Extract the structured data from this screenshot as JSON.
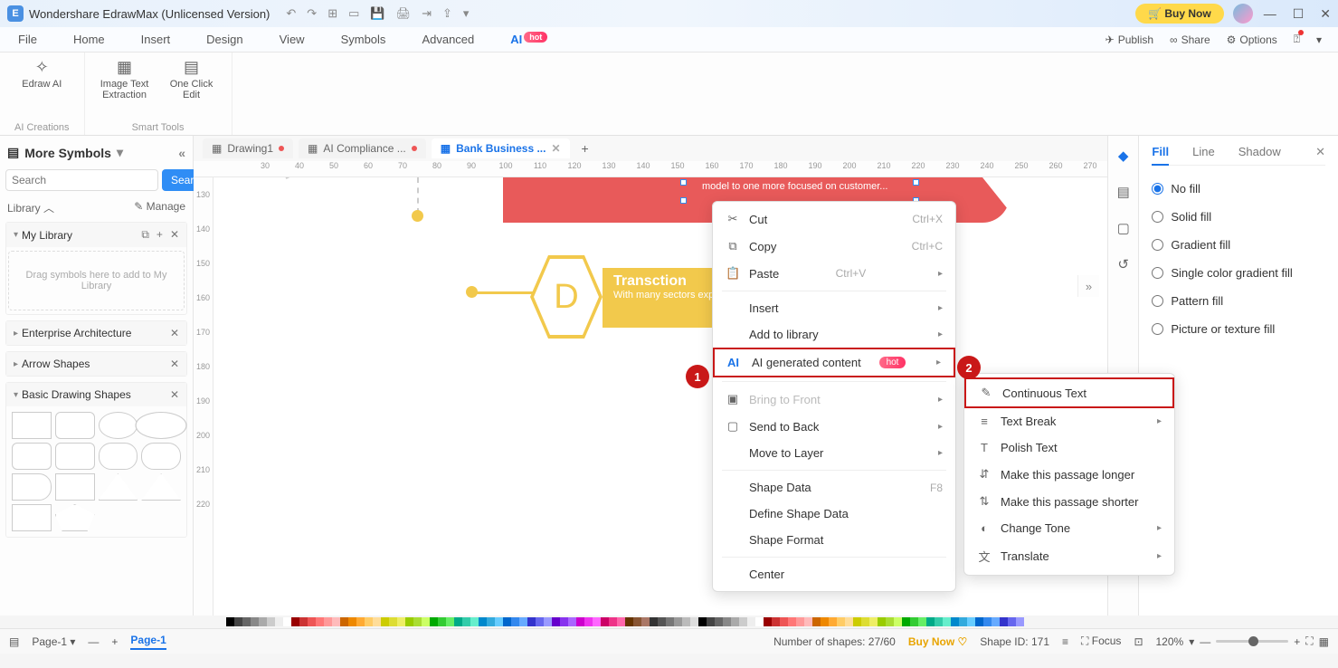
{
  "app": {
    "title": "Wondershare EdrawMax (Unlicensed Version)",
    "buynow": "🛒 Buy Now"
  },
  "winctrl": {
    "min": "—",
    "max": "☐",
    "close": "✕"
  },
  "menubar": {
    "tabs": [
      "File",
      "Home",
      "Insert",
      "Design",
      "View",
      "Symbols",
      "Advanced",
      "AI"
    ],
    "active": "AI",
    "hot": "hot",
    "right": {
      "publish": "Publish",
      "share": "Share",
      "options": "Options"
    }
  },
  "ribbon": {
    "g1": {
      "name": "AI Creations",
      "t1": "Edraw AI"
    },
    "g2": {
      "name": "Smart Tools",
      "t1": "Image Text Extraction",
      "t2": "One Click Edit"
    }
  },
  "left": {
    "title": "More Symbols",
    "searchPlaceholder": "Search",
    "searchBtn": "Search",
    "library": "Library",
    "manage": "Manage",
    "mylib": "My Library",
    "drop": "Drag symbols here to add to My Library",
    "sec1": "Enterprise Architecture",
    "sec2": "Arrow Shapes",
    "sec3": "Basic Drawing Shapes"
  },
  "tabs": {
    "t1": "Drawing1",
    "t2": "AI Compliance ...",
    "t3": "Bank Business ..."
  },
  "rulerH": [
    " ",
    "30",
    "40",
    "50",
    "60",
    "70",
    "80",
    "90",
    "100",
    "110",
    "120",
    "130",
    "140",
    "150",
    "160",
    "170",
    "180",
    "190",
    "200",
    "210",
    "220",
    "230",
    "240",
    "250",
    "260",
    "270"
  ],
  "rulerV": [
    "130",
    "140",
    "150",
    "160",
    "170",
    "180",
    "190",
    "200",
    "210",
    "220"
  ],
  "canvas": {
    "redText": "model to one more focused on customer...",
    "yellowTitle": "Transction",
    "yellowBody": "With many sectors experiencing stress, to gain priority...",
    "hexLetter": "D"
  },
  "ctx": {
    "cut": "Cut",
    "cutK": "Ctrl+X",
    "copy": "Copy",
    "copyK": "Ctrl+C",
    "paste": "Paste",
    "pasteK": "Ctrl+V",
    "insert": "Insert",
    "addlib": "Add to library",
    "ai": "AI generated content",
    "hot": "hot",
    "bring": "Bring to Front",
    "send": "Send to Back",
    "move": "Move to Layer",
    "sdata": "Shape Data",
    "sdataK": "F8",
    "define": "Define Shape Data",
    "format": "Shape Format",
    "center": "Center"
  },
  "sub": {
    "cont": "Continuous Text",
    "break": "Text Break",
    "polish": "Polish Text",
    "longer": "Make this passage longer",
    "shorter": "Make this passage shorter",
    "tone": "Change Tone",
    "trans": "Translate"
  },
  "props": {
    "tabs": {
      "fill": "Fill",
      "line": "Line",
      "shadow": "Shadow"
    },
    "opts": {
      "nofill": "No fill",
      "solid": "Solid fill",
      "grad": "Gradient fill",
      "single": "Single color gradient fill",
      "pattern": "Pattern fill",
      "pic": "Picture or texture fill"
    }
  },
  "status": {
    "page": "Page-1",
    "pageLbl": "Page-1",
    "shapes": "Number of shapes: 27/60",
    "buy": "Buy Now",
    "shapeId": "Shape ID: 171",
    "focus": "Focus",
    "zoom": "120%"
  },
  "markers": {
    "m1": "1",
    "m2": "2"
  }
}
